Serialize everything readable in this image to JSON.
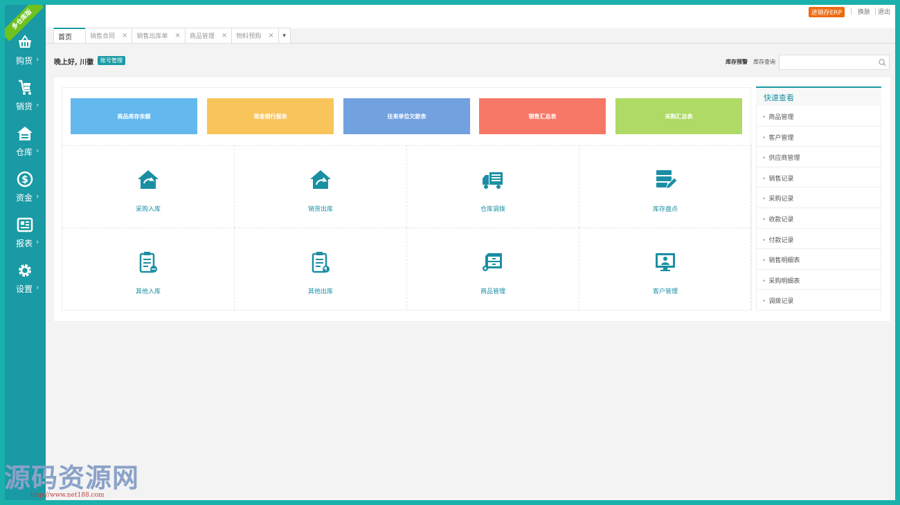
{
  "sidebar": {
    "ribbon": "多仓库版",
    "items": [
      {
        "label": "购货",
        "icon": "basket-icon"
      },
      {
        "label": "销货",
        "icon": "cart-icon"
      },
      {
        "label": "仓库",
        "icon": "warehouse-icon"
      },
      {
        "label": "资金",
        "icon": "dollar-icon"
      },
      {
        "label": "报表",
        "icon": "report-icon"
      },
      {
        "label": "设置",
        "icon": "gear-icon"
      }
    ]
  },
  "topbar": {
    "erp_badge": "进销存ERP",
    "skin": "换肤",
    "logout": "退出"
  },
  "tabs": {
    "home": "首页",
    "items": [
      "销售合同",
      "销售出库单",
      "商品管理",
      "物料预购"
    ],
    "close_glyph": "×"
  },
  "greeting": {
    "text": "晚上好, 川徽",
    "account_button": "账号管理"
  },
  "stock": {
    "warning": "库存预警",
    "query": "库存查询",
    "search_placeholder": ""
  },
  "reports": [
    {
      "label": "商品库存余额",
      "color": "#63b8ee"
    },
    {
      "label": "现金银行报表",
      "color": "#f8c55b"
    },
    {
      "label": "往来单位欠款表",
      "color": "#72a1e0"
    },
    {
      "label": "销售汇总表",
      "color": "#f77767"
    },
    {
      "label": "采购汇总表",
      "color": "#aeda65"
    }
  ],
  "actions": [
    {
      "label": "采购入库",
      "icon": "house-in-icon"
    },
    {
      "label": "销货出库",
      "icon": "house-out-icon"
    },
    {
      "label": "仓库调拨",
      "icon": "truck-icon"
    },
    {
      "label": "库存盘点",
      "icon": "server-edit-icon"
    },
    {
      "label": "其他入库",
      "icon": "clipboard-in-icon"
    },
    {
      "label": "其他出库",
      "icon": "clipboard-out-icon"
    },
    {
      "label": "商品管理",
      "icon": "cabinet-icon"
    },
    {
      "label": "客户管理",
      "icon": "monitor-user-icon"
    }
  ],
  "quick_view": {
    "title": "快速查看",
    "items": [
      "商品管理",
      "客户管理",
      "供应商管理",
      "销售记录",
      "采购记录",
      "收款记录",
      "付款记录",
      "销售明细表",
      "采购明细表",
      "调拨记录"
    ]
  },
  "watermark": {
    "text": "源码资源网",
    "url": "http://www.net188.com"
  },
  "colors": {
    "accent": "#1a9aa4",
    "frame": "#1ab1ac"
  }
}
